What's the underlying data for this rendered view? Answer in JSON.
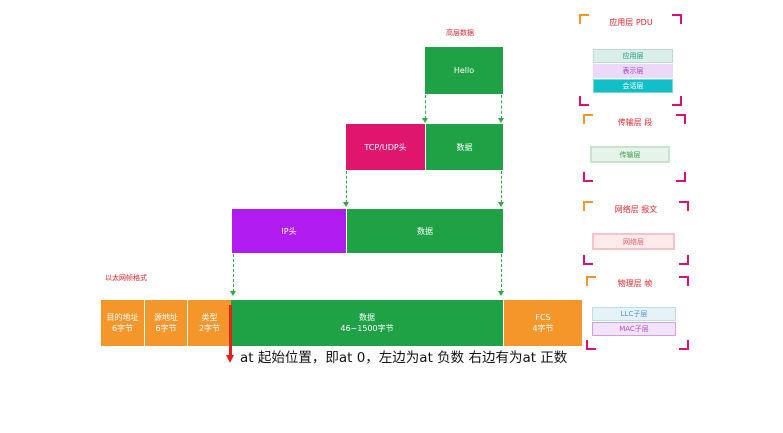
{
  "diagram": {
    "top_label": "高层数据",
    "ethernet_label": "以太网帧格式",
    "hello_box": "Hello",
    "tcp_header": "TCP/UDP头",
    "tcp_data": "数据",
    "ip_header": "IP头",
    "ip_data": "数据",
    "frame": {
      "dest_line1": "目的地址",
      "dest_line2": "6字节",
      "src_line1": "源地址",
      "src_line2": "6字节",
      "type_line1": "类型",
      "type_line2": "2字节",
      "data_line1": "数据",
      "data_line2": "46~1500字节",
      "fcs_line1": "FCS",
      "fcs_line2": "4字节"
    },
    "caption": "at 起始位置，即at 0，左边为at 负数  右边有为at 正数"
  },
  "layers": {
    "app": {
      "title": "应用层 PDU",
      "items": [
        "应用层",
        "表示层",
        "会话层"
      ]
    },
    "transport": {
      "title": "传输层 段",
      "item": "传输层"
    },
    "network": {
      "title": "网络层 报文",
      "item": "网络层"
    },
    "physical": {
      "title": "物理层 帧",
      "items": [
        "LLC子层",
        "MAC子层"
      ]
    }
  },
  "colors": {
    "green": "#1fa246",
    "pink": "#e0166e",
    "purple": "#b01bf0",
    "orange": "#f5962b",
    "red_arrow": "#e32119"
  }
}
